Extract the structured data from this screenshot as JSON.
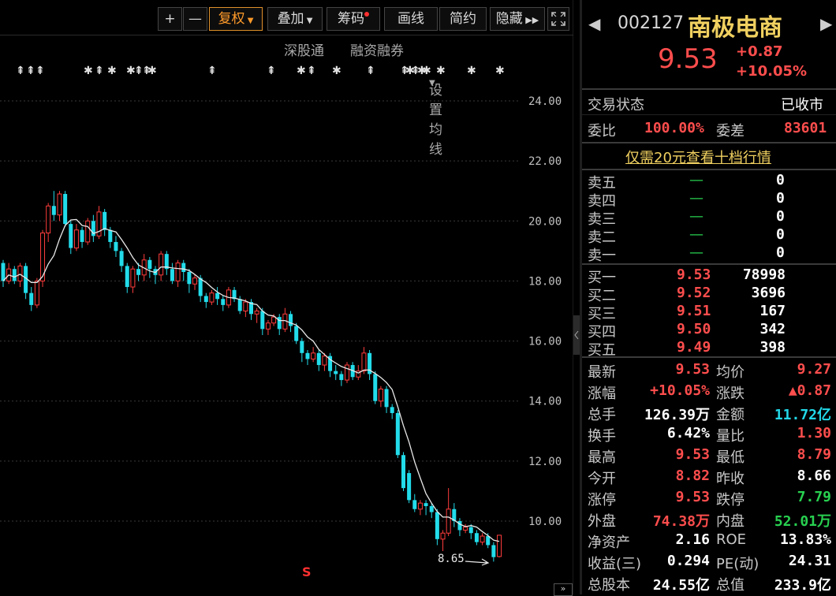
{
  "toolbar": {
    "plus": "+",
    "minus": "—",
    "fuquan": "复权",
    "diejia": "叠加",
    "chouma": "筹码",
    "huaxian": "画线",
    "jianyue": "简约",
    "yincang": "隐藏",
    "expand_icon": "expand-icon"
  },
  "subbar": {
    "shengutong": "深股通",
    "rongzi": "融资融券",
    "junxian": "设置均线"
  },
  "chart_data": {
    "type": "candlestick",
    "yticks": [
      "24.00",
      "22.00",
      "20.00",
      "18.00",
      "16.00",
      "14.00",
      "12.00",
      "10.00"
    ],
    "ylim": [
      8.3,
      25.2
    ],
    "low_label": "8.65",
    "signal_marker": "S",
    "candles": [
      [
        18.6,
        18.0,
        18.7,
        17.8
      ],
      [
        18.0,
        18.4,
        18.6,
        17.9
      ],
      [
        18.4,
        18.0,
        18.5,
        17.9
      ],
      [
        18.0,
        18.5,
        18.6,
        17.8
      ],
      [
        18.5,
        17.6,
        18.6,
        17.4
      ],
      [
        17.6,
        17.2,
        17.8,
        17.0
      ],
      [
        17.2,
        18.0,
        18.1,
        17.1
      ],
      [
        18.0,
        19.6,
        19.7,
        17.8
      ],
      [
        19.6,
        20.5,
        20.6,
        19.3
      ],
      [
        20.5,
        20.2,
        21.0,
        20.0
      ],
      [
        20.2,
        20.9,
        21.0,
        20.0
      ],
      [
        20.9,
        19.9,
        21.0,
        19.8
      ],
      [
        19.9,
        19.1,
        20.0,
        18.9
      ],
      [
        19.1,
        19.7,
        19.9,
        19.0
      ],
      [
        19.7,
        19.3,
        19.8,
        19.1
      ],
      [
        19.3,
        20.0,
        20.1,
        19.2
      ],
      [
        20.0,
        19.5,
        20.2,
        19.3
      ],
      [
        19.5,
        20.3,
        20.5,
        19.4
      ],
      [
        20.3,
        19.7,
        20.4,
        19.5
      ],
      [
        19.7,
        19.3,
        19.8,
        19.1
      ],
      [
        19.3,
        19.0,
        19.5,
        18.8
      ],
      [
        19.0,
        18.5,
        19.1,
        18.3
      ],
      [
        18.5,
        17.8,
        18.6,
        17.6
      ],
      [
        17.8,
        18.4,
        18.5,
        17.6
      ],
      [
        18.4,
        18.2,
        18.6,
        18.0
      ],
      [
        18.2,
        18.7,
        18.9,
        18.0
      ],
      [
        18.7,
        18.4,
        18.8,
        18.1
      ],
      [
        18.4,
        18.2,
        18.5,
        17.9
      ],
      [
        18.2,
        18.9,
        19.0,
        18.0
      ],
      [
        18.9,
        18.4,
        19.0,
        18.2
      ],
      [
        18.4,
        18.0,
        18.6,
        17.9
      ],
      [
        18.0,
        18.6,
        18.7,
        17.8
      ],
      [
        18.6,
        18.3,
        18.7,
        18.0
      ],
      [
        18.3,
        17.9,
        18.4,
        17.6
      ],
      [
        17.9,
        18.1,
        18.2,
        17.7
      ],
      [
        18.1,
        17.5,
        18.2,
        17.3
      ],
      [
        17.5,
        17.3,
        17.6,
        17.1
      ],
      [
        17.3,
        17.6,
        17.7,
        17.2
      ],
      [
        17.6,
        17.4,
        17.8,
        17.2
      ],
      [
        17.4,
        17.2,
        17.5,
        17.0
      ],
      [
        17.2,
        17.7,
        17.8,
        17.1
      ],
      [
        17.7,
        17.4,
        17.8,
        17.3
      ],
      [
        17.4,
        17.0,
        17.5,
        16.9
      ],
      [
        17.0,
        17.3,
        17.4,
        16.8
      ],
      [
        17.3,
        16.9,
        17.4,
        16.7
      ],
      [
        16.9,
        17.0,
        17.1,
        16.6
      ],
      [
        17.0,
        16.4,
        17.1,
        16.2
      ],
      [
        16.4,
        16.6,
        16.7,
        16.2
      ],
      [
        16.6,
        16.8,
        16.9,
        16.5
      ],
      [
        16.8,
        16.4,
        16.9,
        16.2
      ],
      [
        16.4,
        16.9,
        17.1,
        16.3
      ],
      [
        16.9,
        16.5,
        17.0,
        16.3
      ],
      [
        16.5,
        16.0,
        16.6,
        15.9
      ],
      [
        16.0,
        15.6,
        16.1,
        15.3
      ],
      [
        15.6,
        15.4,
        15.7,
        15.2
      ],
      [
        15.4,
        15.6,
        15.8,
        15.3
      ],
      [
        15.6,
        15.2,
        15.7,
        15.0
      ],
      [
        15.2,
        15.5,
        15.6,
        15.0
      ],
      [
        15.5,
        15.0,
        15.6,
        14.8
      ],
      [
        15.0,
        14.9,
        15.2,
        14.7
      ],
      [
        14.9,
        14.7,
        15.0,
        14.5
      ],
      [
        14.7,
        15.2,
        15.3,
        14.6
      ],
      [
        15.2,
        14.8,
        15.3,
        14.7
      ],
      [
        14.8,
        15.0,
        15.2,
        14.7
      ],
      [
        15.0,
        15.6,
        15.8,
        14.9
      ],
      [
        15.6,
        14.9,
        15.7,
        14.7
      ],
      [
        14.9,
        14.0,
        15.0,
        13.9
      ],
      [
        14.0,
        14.4,
        14.5,
        13.8
      ],
      [
        14.4,
        13.8,
        14.5,
        13.6
      ],
      [
        13.8,
        13.6,
        13.9,
        13.4
      ],
      [
        13.6,
        12.2,
        13.7,
        12.1
      ],
      [
        12.2,
        11.1,
        12.3,
        11.0
      ],
      [
        11.6,
        10.7,
        11.7,
        10.6
      ],
      [
        10.7,
        10.4,
        10.9,
        10.3
      ],
      [
        10.4,
        10.6,
        10.7,
        10.2
      ],
      [
        10.6,
        10.5,
        10.7,
        10.2
      ],
      [
        10.5,
        10.3,
        10.6,
        10.1
      ],
      [
        10.3,
        9.4,
        10.4,
        9.2
      ],
      [
        9.4,
        9.6,
        9.7,
        9.0
      ],
      [
        9.6,
        10.4,
        11.1,
        9.5
      ],
      [
        10.4,
        10.0,
        10.6,
        9.8
      ],
      [
        10.0,
        9.7,
        10.1,
        9.5
      ],
      [
        9.7,
        9.8,
        9.9,
        9.6
      ],
      [
        9.8,
        9.6,
        9.9,
        9.4
      ],
      [
        9.6,
        9.3,
        9.7,
        9.2
      ],
      [
        9.3,
        9.5,
        9.6,
        9.2
      ],
      [
        9.5,
        9.2,
        9.6,
        9.1
      ],
      [
        9.2,
        8.8,
        9.3,
        8.65
      ],
      [
        8.82,
        9.53,
        9.53,
        8.79
      ]
    ]
  },
  "quote": {
    "code": "002127",
    "name": "南极电商",
    "price": "9.53",
    "change": "+0.87",
    "pct": "+10.05%",
    "prev_arrow": "◀",
    "next_arrow": "▶"
  },
  "status": {
    "label": "交易状态",
    "value": "已收市"
  },
  "weibi": {
    "label1": "委比",
    "value1": "100.00%",
    "label2": "委差",
    "value2": "83601"
  },
  "ten_level_link": "仅需20元查看十档行情",
  "sell": [
    {
      "label": "卖五",
      "price": "—",
      "vol": "0"
    },
    {
      "label": "卖四",
      "price": "—",
      "vol": "0"
    },
    {
      "label": "卖三",
      "price": "—",
      "vol": "0"
    },
    {
      "label": "卖二",
      "price": "—",
      "vol": "0"
    },
    {
      "label": "卖一",
      "price": "—",
      "vol": "0"
    }
  ],
  "buy": [
    {
      "label": "买一",
      "price": "9.53",
      "vol": "78998"
    },
    {
      "label": "买二",
      "price": "9.52",
      "vol": "3696"
    },
    {
      "label": "买三",
      "price": "9.51",
      "vol": "167"
    },
    {
      "label": "买四",
      "price": "9.50",
      "vol": "342"
    },
    {
      "label": "买五",
      "price": "9.49",
      "vol": "398"
    }
  ],
  "stats": [
    {
      "l1": "最新",
      "v1": "9.53",
      "c1": "red",
      "l2": "均价",
      "v2": "9.27",
      "c2": "red"
    },
    {
      "l1": "涨幅",
      "v1": "+10.05%",
      "c1": "red",
      "l2": "涨跌",
      "v2": "▲0.87",
      "c2": "red"
    },
    {
      "l1": "总手",
      "v1": "126.39万",
      "c1": "white",
      "l2": "金额",
      "v2": "11.72亿",
      "c2": "cyan"
    },
    {
      "l1": "换手",
      "v1": "6.42%",
      "c1": "white",
      "l2": "量比",
      "v2": "1.30",
      "c2": "red"
    },
    {
      "l1": "最高",
      "v1": "9.53",
      "c1": "red",
      "l2": "最低",
      "v2": "8.79",
      "c2": "red"
    },
    {
      "l1": "今开",
      "v1": "8.82",
      "c1": "red",
      "l2": "昨收",
      "v2": "8.66",
      "c2": "white"
    },
    {
      "l1": "涨停",
      "v1": "9.53",
      "c1": "red",
      "l2": "跌停",
      "v2": "7.79",
      "c2": "green"
    },
    {
      "l1": "外盘",
      "v1": "74.38万",
      "c1": "red",
      "l2": "内盘",
      "v2": "52.01万",
      "c2": "green"
    },
    {
      "l1": "净资产",
      "v1": "2.16",
      "c1": "white",
      "l2": "ROE",
      "v2": "13.83%",
      "c2": "white"
    },
    {
      "l1": "收益(三)",
      "v1": "0.294",
      "c1": "white",
      "l2": "PE(动)",
      "v2": "24.31",
      "c2": "white"
    },
    {
      "l1": "总股本",
      "v1": "24.55亿",
      "c1": "white",
      "l2": "总值",
      "v2": "233.9亿",
      "c2": "white"
    }
  ]
}
